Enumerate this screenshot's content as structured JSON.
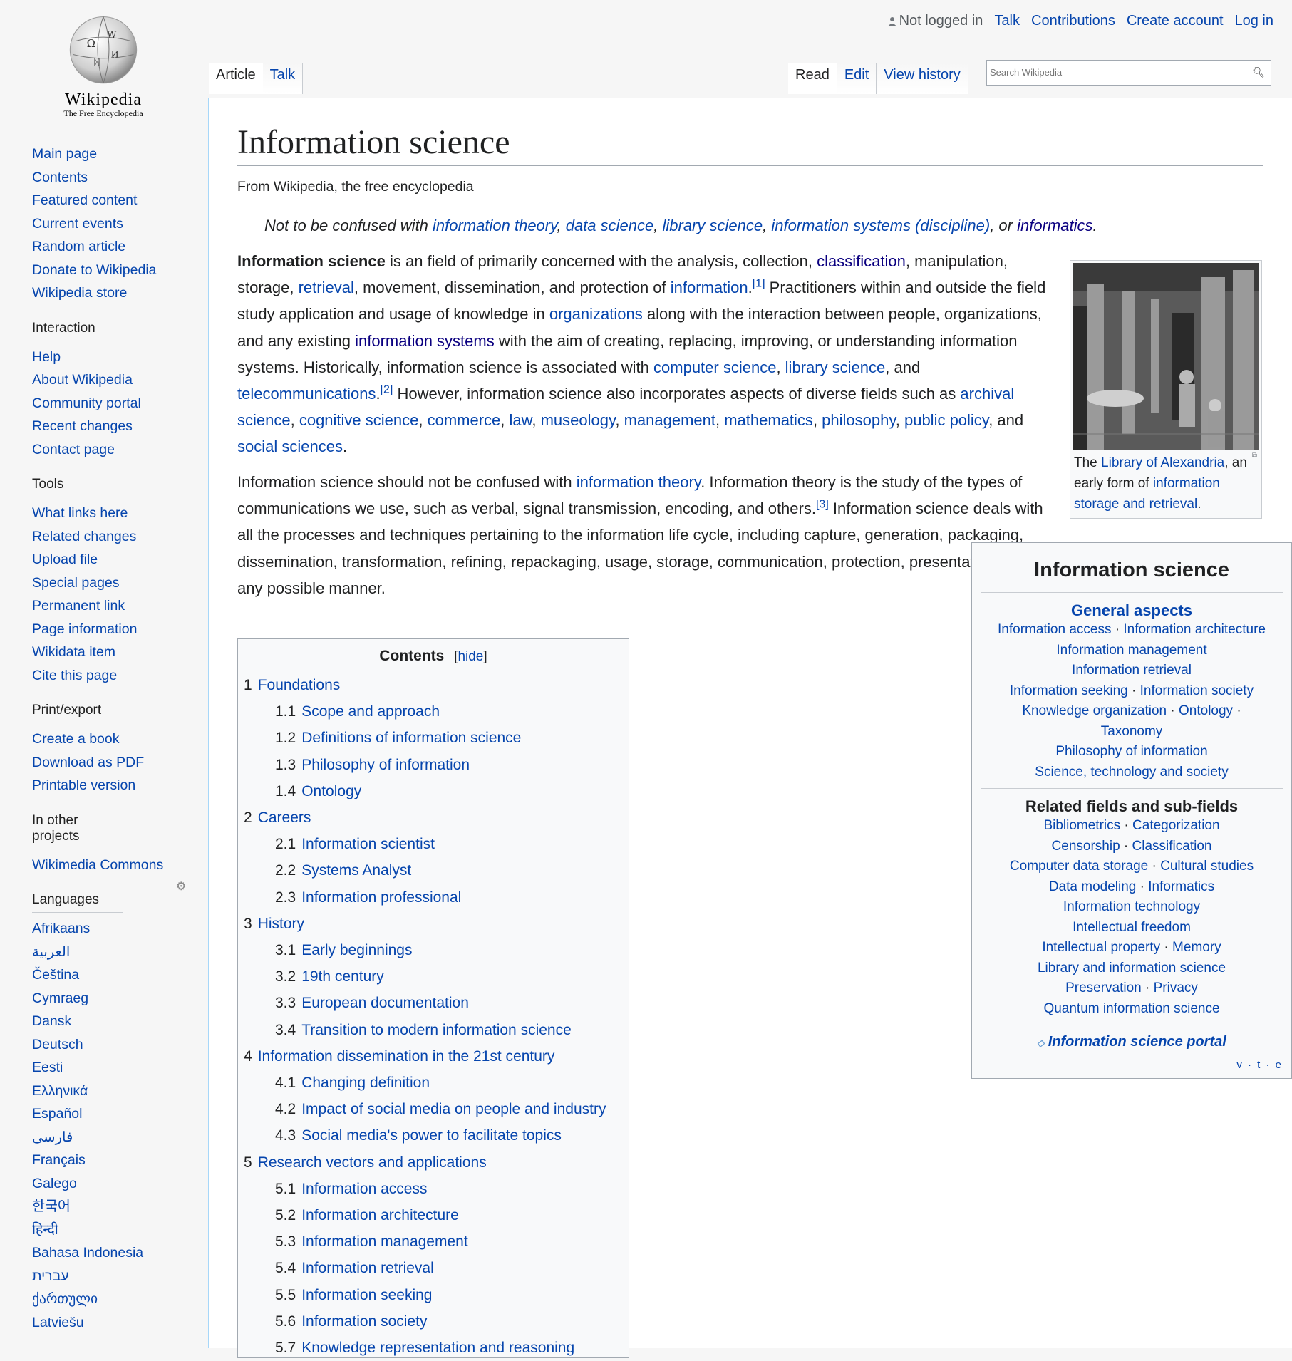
{
  "logo": {
    "wordmark": "Wikipedia",
    "tagline": "The Free Encyclopedia"
  },
  "personal": {
    "not_logged": "Not logged in",
    "talk": "Talk",
    "contributions": "Contributions",
    "create_account": "Create account",
    "login": "Log in"
  },
  "tabs": {
    "article": "Article",
    "talk": "Talk",
    "read": "Read",
    "edit": "Edit",
    "history": "View history"
  },
  "search": {
    "placeholder": "Search Wikipedia"
  },
  "sidebar": {
    "nav": [
      "Main page",
      "Contents",
      "Featured content",
      "Current events",
      "Random article",
      "Donate to Wikipedia",
      "Wikipedia store"
    ],
    "interaction": {
      "title": "Interaction",
      "items": [
        "Help",
        "About Wikipedia",
        "Community portal",
        "Recent changes",
        "Contact page"
      ]
    },
    "tools": {
      "title": "Tools",
      "items": [
        "What links here",
        "Related changes",
        "Upload file",
        "Special pages",
        "Permanent link",
        "Page information",
        "Wikidata item",
        "Cite this page"
      ]
    },
    "print": {
      "title": "Print/export",
      "items": [
        "Create a book",
        "Download as PDF",
        "Printable version"
      ]
    },
    "projects": {
      "title": "In other projects",
      "items": [
        "Wikimedia Commons"
      ]
    },
    "languages": {
      "title": "Languages",
      "items": [
        "Afrikaans",
        "العربية",
        "Čeština",
        "Cymraeg",
        "Dansk",
        "Deutsch",
        "Eesti",
        "Ελληνικά",
        "Español",
        "فارسی",
        "Français",
        "Galego",
        "한국어",
        "हिन्दी",
        "Bahasa Indonesia",
        "עברית",
        "ქართული",
        "Latviešu"
      ]
    }
  },
  "article": {
    "title": "Information science",
    "sitesub": "From Wikipedia, the free encyclopedia",
    "hatnote": {
      "prefix": "Not to be confused with ",
      "l1": "information theory",
      "l2": "data science",
      "l3": "library science",
      "l4": "information systems (discipline)",
      "or": ", or ",
      "l5": "informatics"
    },
    "p1": {
      "b": "Information science",
      "t1": " is an field of primarily concerned with the analysis, collection, ",
      "a1": "classification",
      "t2": ", manipulation, storage, ",
      "a2": "retrieval",
      "t3": ", movement, dissemination, and protection of ",
      "a3": "information",
      "r1": "[1]",
      "t4": " Practitioners within and outside the field study application and usage of knowledge in ",
      "a4": "organizations",
      "t5": " along with the interaction between people, organizations, and any existing ",
      "a5": "information systems",
      "t6": " with the aim of creating, replacing, improving, or understanding information systems. Historically, information science is associated with ",
      "a6": "computer science",
      "a7": "library science",
      "t7": ", and ",
      "a8": "telecommunications",
      "r2": "[2]",
      "t8": " However, information science also incorporates aspects of diverse fields such as ",
      "a9": "archival science",
      "a10": "cognitive science",
      "a11": "commerce",
      "a12": "law",
      "a13": "museology",
      "a14": "management",
      "a15": "mathematics",
      "a16": "philosophy",
      "a17": "public policy",
      "t9": ", and ",
      "a18": "social sciences"
    },
    "p2": {
      "t1": "Information science should not be confused with ",
      "a1": "information theory",
      "t2": ". Information theory is the study of the types of communications we use, such as verbal, signal transmission, encoding, and others.",
      "r3": "[3]",
      "t3": " Information science deals with all the processes and techniques pertaining to the information life cycle, including capture, generation, packaging, dissemination, transformation, refining, repackaging, usage, storage, communication, protection, presentation etc. in any possible manner."
    }
  },
  "thumb": {
    "cap1": "The ",
    "a1": "Library of Alexandria",
    "cap2": ", an early form of ",
    "a2": "information storage and retrieval"
  },
  "infobox": {
    "title": "Information science",
    "general": "General aspects",
    "general_items": [
      [
        "Information access",
        "Information architecture"
      ],
      [
        "Information management"
      ],
      [
        "Information retrieval"
      ],
      [
        "Information seeking",
        "Information society"
      ],
      [
        "Knowledge organization",
        "Ontology"
      ],
      [
        "Taxonomy"
      ],
      [
        "Philosophy of information"
      ],
      [
        "Science, technology and society"
      ]
    ],
    "related": "Related fields and sub-fields",
    "related_items": [
      [
        "Bibliometrics",
        "Categorization"
      ],
      [
        "Censorship",
        "Classification"
      ],
      [
        "Computer data storage",
        "Cultural studies"
      ],
      [
        "Data modeling",
        "Informatics"
      ],
      [
        "Information technology"
      ],
      [
        "Intellectual freedom"
      ],
      [
        "Intellectual property",
        "Memory"
      ],
      [
        "Library and information science"
      ],
      [
        "Preservation",
        "Privacy"
      ],
      [
        "Quantum information science"
      ]
    ],
    "portal": "Information science portal",
    "vte": "v · t · e"
  },
  "toc": {
    "title": "Contents",
    "hide": "hide",
    "items": [
      {
        "n": "1",
        "t": "Foundations",
        "l": 1
      },
      {
        "n": "1.1",
        "t": "Scope and approach",
        "l": 2
      },
      {
        "n": "1.2",
        "t": "Definitions of information science",
        "l": 2
      },
      {
        "n": "1.3",
        "t": "Philosophy of information",
        "l": 2
      },
      {
        "n": "1.4",
        "t": "Ontology",
        "l": 2
      },
      {
        "n": "2",
        "t": "Careers",
        "l": 1
      },
      {
        "n": "2.1",
        "t": "Information scientist",
        "l": 2
      },
      {
        "n": "2.2",
        "t": "Systems Analyst",
        "l": 2
      },
      {
        "n": "2.3",
        "t": "Information professional",
        "l": 2
      },
      {
        "n": "3",
        "t": "History",
        "l": 1
      },
      {
        "n": "3.1",
        "t": "Early beginnings",
        "l": 2
      },
      {
        "n": "3.2",
        "t": "19th century",
        "l": 2
      },
      {
        "n": "3.3",
        "t": "European documentation",
        "l": 2
      },
      {
        "n": "3.4",
        "t": "Transition to modern information science",
        "l": 2
      },
      {
        "n": "4",
        "t": "Information dissemination in the 21st century",
        "l": 1
      },
      {
        "n": "4.1",
        "t": "Changing definition",
        "l": 2
      },
      {
        "n": "4.2",
        "t": "Impact of social media on people and industry",
        "l": 2
      },
      {
        "n": "4.3",
        "t": "Social media's power to facilitate topics",
        "l": 2
      },
      {
        "n": "5",
        "t": "Research vectors and applications",
        "l": 1
      },
      {
        "n": "5.1",
        "t": "Information access",
        "l": 2
      },
      {
        "n": "5.2",
        "t": "Information architecture",
        "l": 2
      },
      {
        "n": "5.3",
        "t": "Information management",
        "l": 2
      },
      {
        "n": "5.4",
        "t": "Information retrieval",
        "l": 2
      },
      {
        "n": "5.5",
        "t": "Information seeking",
        "l": 2
      },
      {
        "n": "5.6",
        "t": "Information society",
        "l": 2
      },
      {
        "n": "5.7",
        "t": "Knowledge representation and reasoning",
        "l": 2
      }
    ]
  }
}
